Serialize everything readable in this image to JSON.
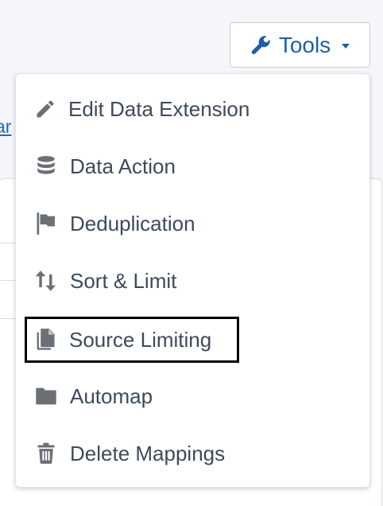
{
  "toolbar": {
    "tools_label": "Tools"
  },
  "background": {
    "link_fragment": "ar"
  },
  "menu": {
    "items": [
      {
        "label": "Edit Data Extension",
        "icon": "pencil-icon"
      },
      {
        "label": "Data Action",
        "icon": "database-icon"
      },
      {
        "label": "Deduplication",
        "icon": "flag-icon"
      },
      {
        "label": "Sort & Limit",
        "icon": "sort-arrows-icon"
      },
      {
        "label": "Source Limiting",
        "icon": "copy-icon",
        "highlighted": true
      },
      {
        "label": "Automap",
        "icon": "folder-icon"
      },
      {
        "label": "Delete Mappings",
        "icon": "trash-icon"
      }
    ]
  },
  "colors": {
    "accent": "#1c5fa8",
    "menu_text": "#3e4a5c",
    "icon": "#6b6f76",
    "highlight_border": "#000000"
  }
}
